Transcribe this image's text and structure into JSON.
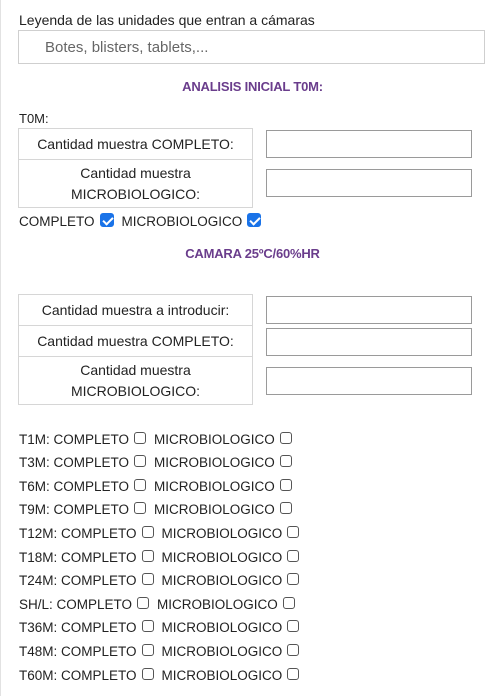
{
  "legend": {
    "label": "Leyenda de las unidades que entran a cámaras",
    "placeholder": "Botes, blisters, tablets,..."
  },
  "initial": {
    "title": "ANALISIS INICIAL T0M:",
    "t0m_label": "T0M:",
    "completo_label": "Cantidad muestra COMPLETO:",
    "micro_label_1": "Cantidad muestra",
    "micro_label_2": "MICROBIOLOGICO:",
    "check_completo": "COMPLETO",
    "check_micro": "MICROBIOLOGICO",
    "completo_checked": true,
    "micro_checked": true
  },
  "camera": {
    "title": "CAMARA 25ºC/60%HR",
    "introduce_label": "Cantidad muestra a introducir:",
    "completo_label": "Cantidad muestra COMPLETO:",
    "micro_label_1": "Cantidad muestra",
    "micro_label_2": "MICROBIOLOGICO:"
  },
  "timepoints": [
    {
      "label": "T1M: COMPLETO",
      "micro": "MICROBIOLOGICO",
      "completo_checked": false,
      "micro_checked": false
    },
    {
      "label": "T3M: COMPLETO",
      "micro": "MICROBIOLOGICO",
      "completo_checked": false,
      "micro_checked": false
    },
    {
      "label": "T6M: COMPLETO",
      "micro": "MICROBIOLOGICO",
      "completo_checked": false,
      "micro_checked": false
    },
    {
      "label": "T9M: COMPLETO",
      "micro": "MICROBIOLOGICO",
      "completo_checked": false,
      "micro_checked": false
    },
    {
      "label": "T12M: COMPLETO",
      "micro": "MICROBIOLOGICO",
      "completo_checked": false,
      "micro_checked": false
    },
    {
      "label": "T18M: COMPLETO",
      "micro": "MICROBIOLOGICO",
      "completo_checked": false,
      "micro_checked": false
    },
    {
      "label": "T24M: COMPLETO",
      "micro": "MICROBIOLOGICO",
      "completo_checked": false,
      "micro_checked": false
    },
    {
      "label": "SH/L: COMPLETO",
      "micro": "MICROBIOLOGICO",
      "completo_checked": false,
      "micro_checked": false
    },
    {
      "label": "T36M: COMPLETO",
      "micro": "MICROBIOLOGICO",
      "completo_checked": false,
      "micro_checked": false
    },
    {
      "label": "T48M: COMPLETO",
      "micro": "MICROBIOLOGICO",
      "completo_checked": false,
      "micro_checked": false
    },
    {
      "label": "T60M: COMPLETO",
      "micro": "MICROBIOLOGICO",
      "completo_checked": false,
      "micro_checked": false
    }
  ],
  "colors": {
    "section_title": "#6a3d8c",
    "checkbox_checked": "#1a73e8"
  }
}
